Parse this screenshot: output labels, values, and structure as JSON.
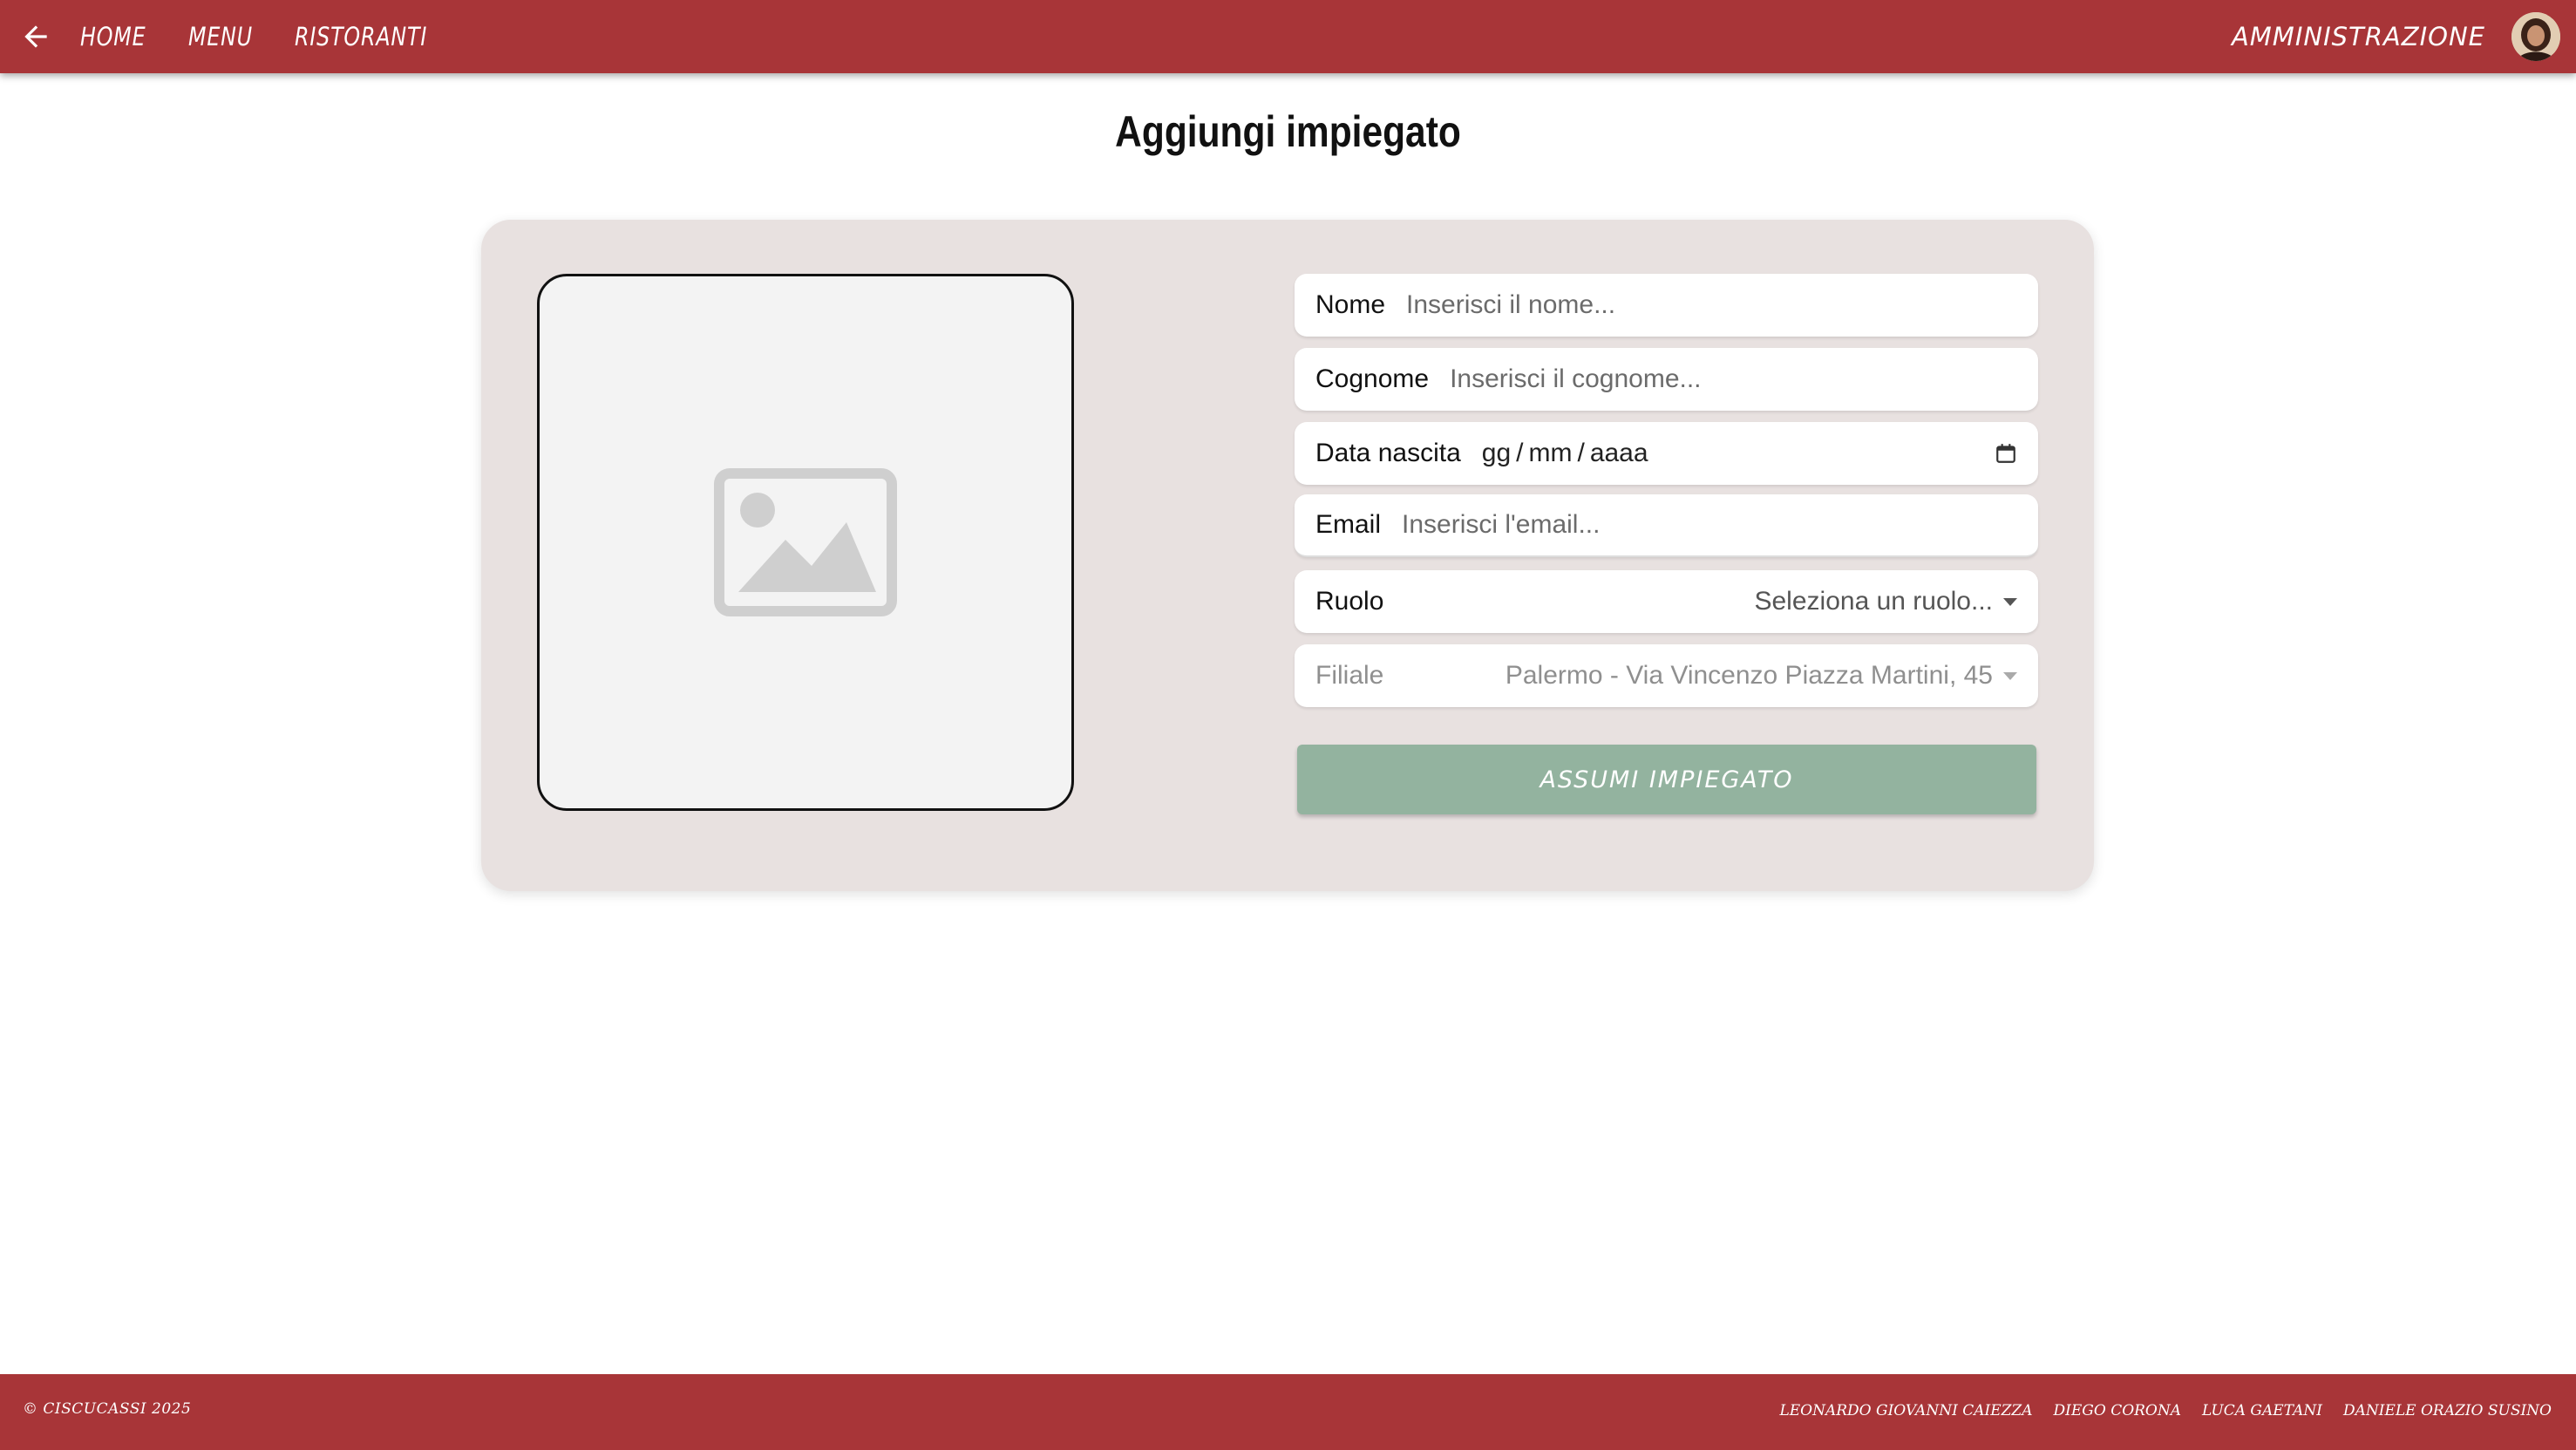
{
  "navbar": {
    "back_icon": "arrow-left-icon",
    "links": [
      "HOME",
      "MENU",
      "RISTORANTI"
    ],
    "admin_label": "AMMINISTRAZIONE",
    "avatar_icon": "user-avatar"
  },
  "page": {
    "title": "Aggiungi impiegato"
  },
  "form": {
    "image_placeholder_icon": "image-placeholder-icon",
    "nome": {
      "label": "Nome",
      "placeholder": "Inserisci il nome...",
      "value": ""
    },
    "cognome": {
      "label": "Cognome",
      "placeholder": "Inserisci il cognome...",
      "value": ""
    },
    "data_nascita": {
      "label": "Data nascita",
      "day": "gg",
      "month": "mm",
      "year": "aaaa",
      "sep": "/",
      "icon": "calendar-icon"
    },
    "email": {
      "label": "Email",
      "placeholder": "Inserisci l'email...",
      "value": ""
    },
    "ruolo": {
      "label": "Ruolo",
      "selected": "Seleziona un ruolo..."
    },
    "filiale": {
      "label": "Filiale",
      "selected": "Palermo - Via Vincenzo Piazza Martini, 45",
      "disabled": true
    },
    "submit_label": "ASSUMI IMPIEGATO",
    "submit_disabled": true
  },
  "footer": {
    "copyright": "© CISCUCASSI 2025",
    "authors": [
      "LEONARDO GIOVANNI CAIEZZA",
      "DIEGO CORONA",
      "LUCA GAETANI",
      "DANIELE ORAZIO SUSINO"
    ]
  },
  "colors": {
    "primary": "#a83538",
    "card_bg": "#e8e1e0",
    "button": "#93b39f",
    "image_bg": "#f3f3f3"
  }
}
